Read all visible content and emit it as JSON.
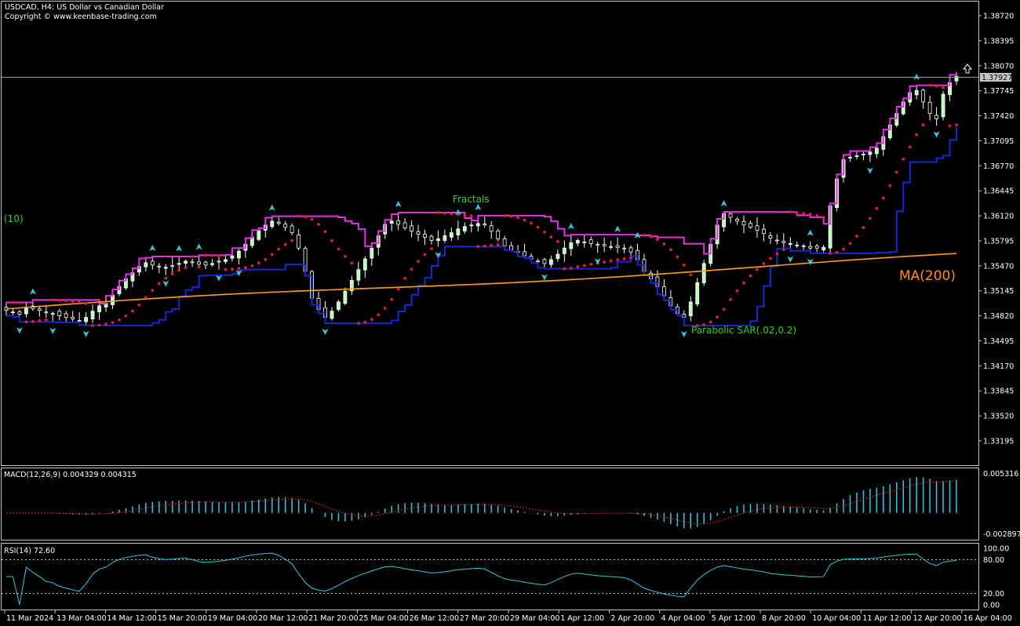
{
  "header": {
    "title": "USDCAD, H4:  US Dollar vs Canadian Dollar",
    "copyright": "Copyright © www.keenbase-trading.com"
  },
  "labels": {
    "fractals": "Fractals",
    "ma": "MA(200)",
    "sar": "Parabolic SAR(.02,0.2)",
    "period": "(10)",
    "macd": "MACD(12,26,9) 0.004329 0.004315",
    "rsi": "RSI(14) 72.60",
    "price_tag": "1.37927"
  },
  "colors": {
    "background": "#000000",
    "frame": "#c8c8c8",
    "candle": "#ffffff",
    "candle_bull": "#b6ffb6",
    "upper_channel": "#e632e6",
    "lower_channel": "#1428d2",
    "ma": "#ff9f1c",
    "sar": "#e0203a",
    "fractal": "#33c6d6",
    "macd_hist": "#33c6e6",
    "macd_signal": "#e02020",
    "rsi": "#33c6e6",
    "annotation": "#2fd02f"
  },
  "chart_data": [
    {
      "type": "candlestick",
      "symbol": "USDCAD",
      "timeframe": "H4",
      "ylim": [
        1.329,
        1.389
      ],
      "y_ticks": [
        "1.38720",
        "1.38395",
        "1.38070",
        "1.37745",
        "1.37420",
        "1.37095",
        "1.36770",
        "1.36445",
        "1.36120",
        "1.35795",
        "1.35470",
        "1.35145",
        "1.34820",
        "1.34495",
        "1.34170",
        "1.33845",
        "1.33520",
        "1.33195"
      ],
      "x_ticks": [
        "11 Mar 2024",
        "13 Mar 04:00",
        "14 Mar 12:00",
        "15 Mar 20:00",
        "19 Mar 04:00",
        "20 Mar 12:00",
        "21 Mar 20:00",
        "25 Mar 04:00",
        "26 Mar 12:00",
        "27 Mar 20:00",
        "29 Mar 04:00",
        "1 Apr 12:00",
        "2 Apr 20:00",
        "4 Apr 04:00",
        "5 Apr 12:00",
        "8 Apr 20:00",
        "10 Apr 04:00",
        "11 Apr 12:00",
        "12 Apr 20:00",
        "16 Apr 04:00"
      ],
      "last_price": 1.37927,
      "close_trend": [
        1.3489,
        1.3487,
        1.3484,
        1.3493,
        1.3491,
        1.3489,
        1.3486,
        1.3485,
        1.3482,
        1.348,
        1.3478,
        1.3476,
        1.348,
        1.3488,
        1.3495,
        1.3498,
        1.3509,
        1.352,
        1.353,
        1.3538,
        1.3546,
        1.3551,
        1.3548,
        1.3546,
        1.3545,
        1.3547,
        1.355,
        1.3553,
        1.3551,
        1.3549,
        1.3548,
        1.355,
        1.3552,
        1.3555,
        1.356,
        1.3566,
        1.3575,
        1.3584,
        1.3593,
        1.36,
        1.3605,
        1.3602,
        1.3597,
        1.359,
        1.357,
        1.354,
        1.3505,
        1.349,
        1.348,
        1.3488,
        1.35,
        1.3514,
        1.3528,
        1.3542,
        1.3556,
        1.357,
        1.3586,
        1.3601,
        1.3605,
        1.3601,
        1.3596,
        1.3592,
        1.3588,
        1.3584,
        1.358,
        1.3582,
        1.3586,
        1.359,
        1.3595,
        1.3598,
        1.36,
        1.3602,
        1.36,
        1.3592,
        1.3582,
        1.3573,
        1.3568,
        1.3565,
        1.356,
        1.3556,
        1.3553,
        1.355,
        1.3555,
        1.3562,
        1.357,
        1.3577,
        1.358,
        1.3578,
        1.3576,
        1.3574,
        1.3573,
        1.3572,
        1.3571,
        1.357,
        1.3565,
        1.3555,
        1.354,
        1.353,
        1.352,
        1.3508,
        1.3495,
        1.3485,
        1.348,
        1.35,
        1.3525,
        1.355,
        1.3575,
        1.36,
        1.3615,
        1.361,
        1.3605,
        1.36,
        1.3597,
        1.3593,
        1.3589,
        1.3583,
        1.358,
        1.3577,
        1.3576,
        1.3574,
        1.3572,
        1.357,
        1.357,
        1.3571,
        1.3625,
        1.366,
        1.3685,
        1.3688,
        1.369,
        1.3692,
        1.3695,
        1.37,
        1.3715,
        1.373,
        1.3745,
        1.376,
        1.3772,
        1.3775,
        1.376,
        1.3745,
        1.3738,
        1.377,
        1.3785,
        1.3793
      ],
      "macd_range": [
        -0.002897,
        0.005316
      ],
      "macd_labels": [
        "0.005316",
        "-0.002897"
      ],
      "rsi_levels": [
        100,
        80,
        20,
        0
      ],
      "rsi_labels": [
        "100.00",
        "80.00",
        "20.00",
        "0.00"
      ]
    }
  ]
}
